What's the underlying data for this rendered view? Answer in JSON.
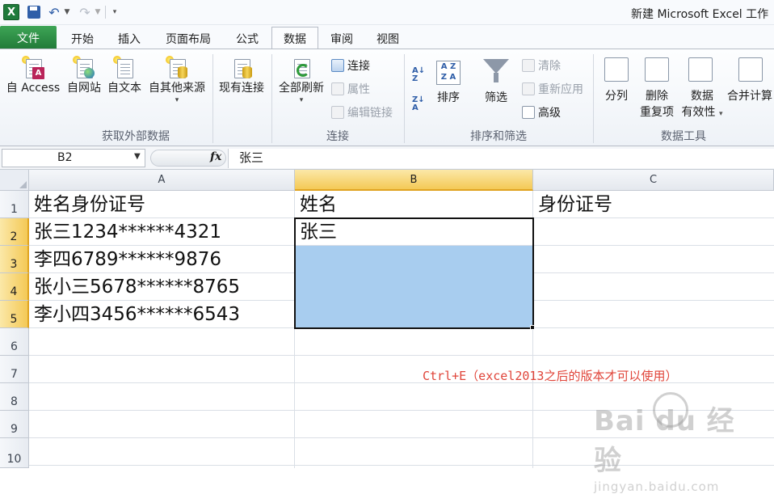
{
  "app": {
    "title": "新建 Microsoft Excel 工作",
    "excel_logo_letter": "X",
    "quick_access": [
      "save-icon",
      "undo-icon",
      "redo-icon",
      "customize-icon"
    ]
  },
  "tabs": {
    "file": "文件",
    "items": [
      "开始",
      "插入",
      "页面布局",
      "公式",
      "数据",
      "审阅",
      "视图"
    ],
    "active": "数据"
  },
  "ribbon": {
    "external_data": {
      "group_label": "获取外部数据",
      "from_access": "自 Access",
      "from_web": "自网站",
      "from_text": "自文本",
      "from_other": "自其他来源",
      "existing": "现有连接"
    },
    "connections": {
      "group_label": "连接",
      "refresh_all": "全部刷新",
      "connections": "连接",
      "properties": "属性",
      "edit_links": "编辑链接"
    },
    "sort_filter": {
      "group_label": "排序和筛选",
      "sort": "排序",
      "filter": "筛选",
      "clear": "清除",
      "reapply": "重新应用",
      "advanced": "高级"
    },
    "data_tools": {
      "group_label": "数据工具",
      "text_to_columns": "分列",
      "remove_duplicates_line1": "删除",
      "remove_duplicates_line2": "重复项",
      "validation_line1": "数据",
      "validation_line2": "有效性",
      "consolidate": "合并计算"
    }
  },
  "formula_bar": {
    "name_box": "B2",
    "fx_label": "fx",
    "value": "张三"
  },
  "sheet": {
    "columns": [
      "A",
      "B",
      "C"
    ],
    "selected_column": "B",
    "rows": [
      "1",
      "2",
      "3",
      "4",
      "5",
      "6",
      "7",
      "8",
      "9",
      "10"
    ],
    "selected_rows": [
      "2",
      "3",
      "4",
      "5"
    ],
    "cells": {
      "A1": "姓名身份证号",
      "B1": "姓名",
      "C1": "身份证号",
      "A2": "张三1234******4321",
      "B2": "张三",
      "A3": "李四6789******9876",
      "A4": "张小三5678******8765",
      "A5": "李小四3456******6543"
    },
    "selection": "B2:B5",
    "note": "Ctrl+E（excel2013之后的版本才可以使用）"
  },
  "watermark": {
    "main": "Bai du 经验",
    "sub": "jingyan.baidu.com"
  },
  "colors": {
    "file_tab": "#217a38",
    "selection_fill": "#a8cdef",
    "header_highlight": "#f4c956",
    "note_text": "#e0453a"
  }
}
